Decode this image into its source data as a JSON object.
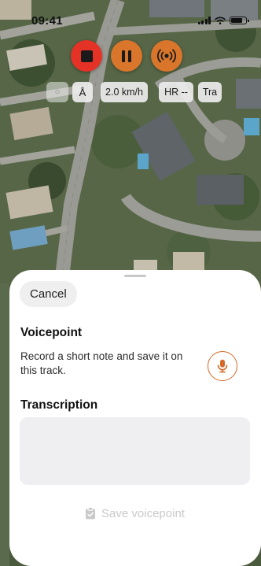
{
  "status_bar": {
    "time": "09:41"
  },
  "map": {
    "description_icon": "satellite-map"
  },
  "controls": {
    "stop_icon": "stop-icon",
    "pause_icon": "pause-icon",
    "broadcast_icon": "broadcast-icon",
    "colors": {
      "stop": "#e53227",
      "pause": "#d9762b",
      "broadcast": "#d9762b"
    }
  },
  "chips": {
    "gps": "○",
    "compass": "Å",
    "speed": "2.0 km/h",
    "heart_rate": "HR --",
    "track": "Tra"
  },
  "sheet": {
    "cancel_label": "Cancel",
    "voicepoint_title": "Voicepoint",
    "voicepoint_description": "Record a short note and save it on this track.",
    "mic_icon": "microphone-icon",
    "transcription_title": "Transcription",
    "transcription_value": "",
    "save_label": "Save voicepoint",
    "save_icon": "clipboard-icon",
    "accent_color": "#d46a2a"
  }
}
